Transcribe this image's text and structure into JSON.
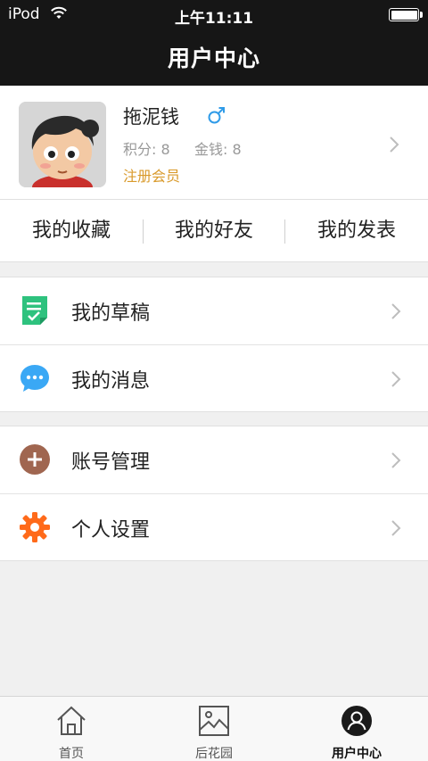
{
  "status_bar": {
    "carrier": "iPod",
    "time": "上午11:11",
    "battery_level": 1.0
  },
  "nav": {
    "title": "用户中心"
  },
  "profile": {
    "username": "拖泥钱",
    "gender_symbol": "♂",
    "points": "积分: 8",
    "coins": "金钱: 8",
    "member_level": "注册会员"
  },
  "quick_tabs": [
    {
      "label": "我的收藏"
    },
    {
      "label": "我的好友"
    },
    {
      "label": "我的发表"
    }
  ],
  "menu_group_1": [
    {
      "label": "我的草稿",
      "icon": "draft-icon",
      "color": "#2ec27e"
    },
    {
      "label": "我的消息",
      "icon": "message-icon",
      "color": "#3aa8f5"
    }
  ],
  "menu_group_2": [
    {
      "label": "账号管理",
      "icon": "account-icon",
      "color": "#a06650"
    },
    {
      "label": "个人设置",
      "icon": "settings-icon",
      "color": "#ff6a1a"
    }
  ],
  "tab_bar": [
    {
      "label": "首页",
      "icon": "home-icon"
    },
    {
      "label": "后花园",
      "icon": "image-icon"
    },
    {
      "label": "用户中心",
      "icon": "user-icon",
      "active": true
    }
  ],
  "colors": {
    "header_bg": "#161616",
    "member_gold": "#d99a2b",
    "page_bg": "#f0f0f0"
  }
}
